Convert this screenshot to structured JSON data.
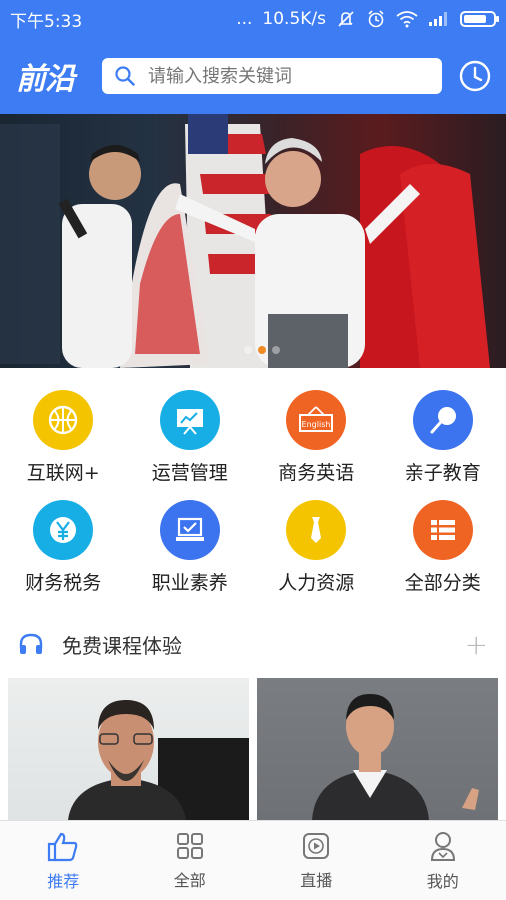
{
  "status_bar": {
    "time": "下午5:33",
    "dots": "...",
    "speed": "10.5K/s"
  },
  "header": {
    "logo": "前沿",
    "search_placeholder": "请输入搜索关键词"
  },
  "banner": {
    "slide_count": 3,
    "active_index": 1
  },
  "categories": [
    {
      "label": "互联网+",
      "icon": "basketball-icon",
      "color": "#f5c400"
    },
    {
      "label": "运营管理",
      "icon": "presentation-chart-icon",
      "color": "#17aee6"
    },
    {
      "label": "商务英语",
      "icon": "english-sign-icon",
      "color": "#f06423"
    },
    {
      "label": "亲子教育",
      "icon": "lollipop-icon",
      "color": "#3b74ee"
    },
    {
      "label": "财务税务",
      "icon": "yuan-coin-icon",
      "color": "#17aee6"
    },
    {
      "label": "职业素养",
      "icon": "laptop-check-icon",
      "color": "#3b74ee"
    },
    {
      "label": "人力资源",
      "icon": "tie-icon",
      "color": "#f5c400"
    },
    {
      "label": "全部分类",
      "icon": "list-icon",
      "color": "#f06423"
    }
  ],
  "section": {
    "title": "免费课程体验",
    "more": "+"
  },
  "bottom_nav": [
    {
      "label": "推荐",
      "icon": "thumbs-up-icon",
      "active": true
    },
    {
      "label": "全部",
      "icon": "grid-icon",
      "active": false
    },
    {
      "label": "直播",
      "icon": "play-screen-icon",
      "active": false
    },
    {
      "label": "我的",
      "icon": "user-icon",
      "active": false
    }
  ],
  "colors": {
    "brand_blue": "#3d7cf2",
    "active_dot": "#f08a24"
  }
}
